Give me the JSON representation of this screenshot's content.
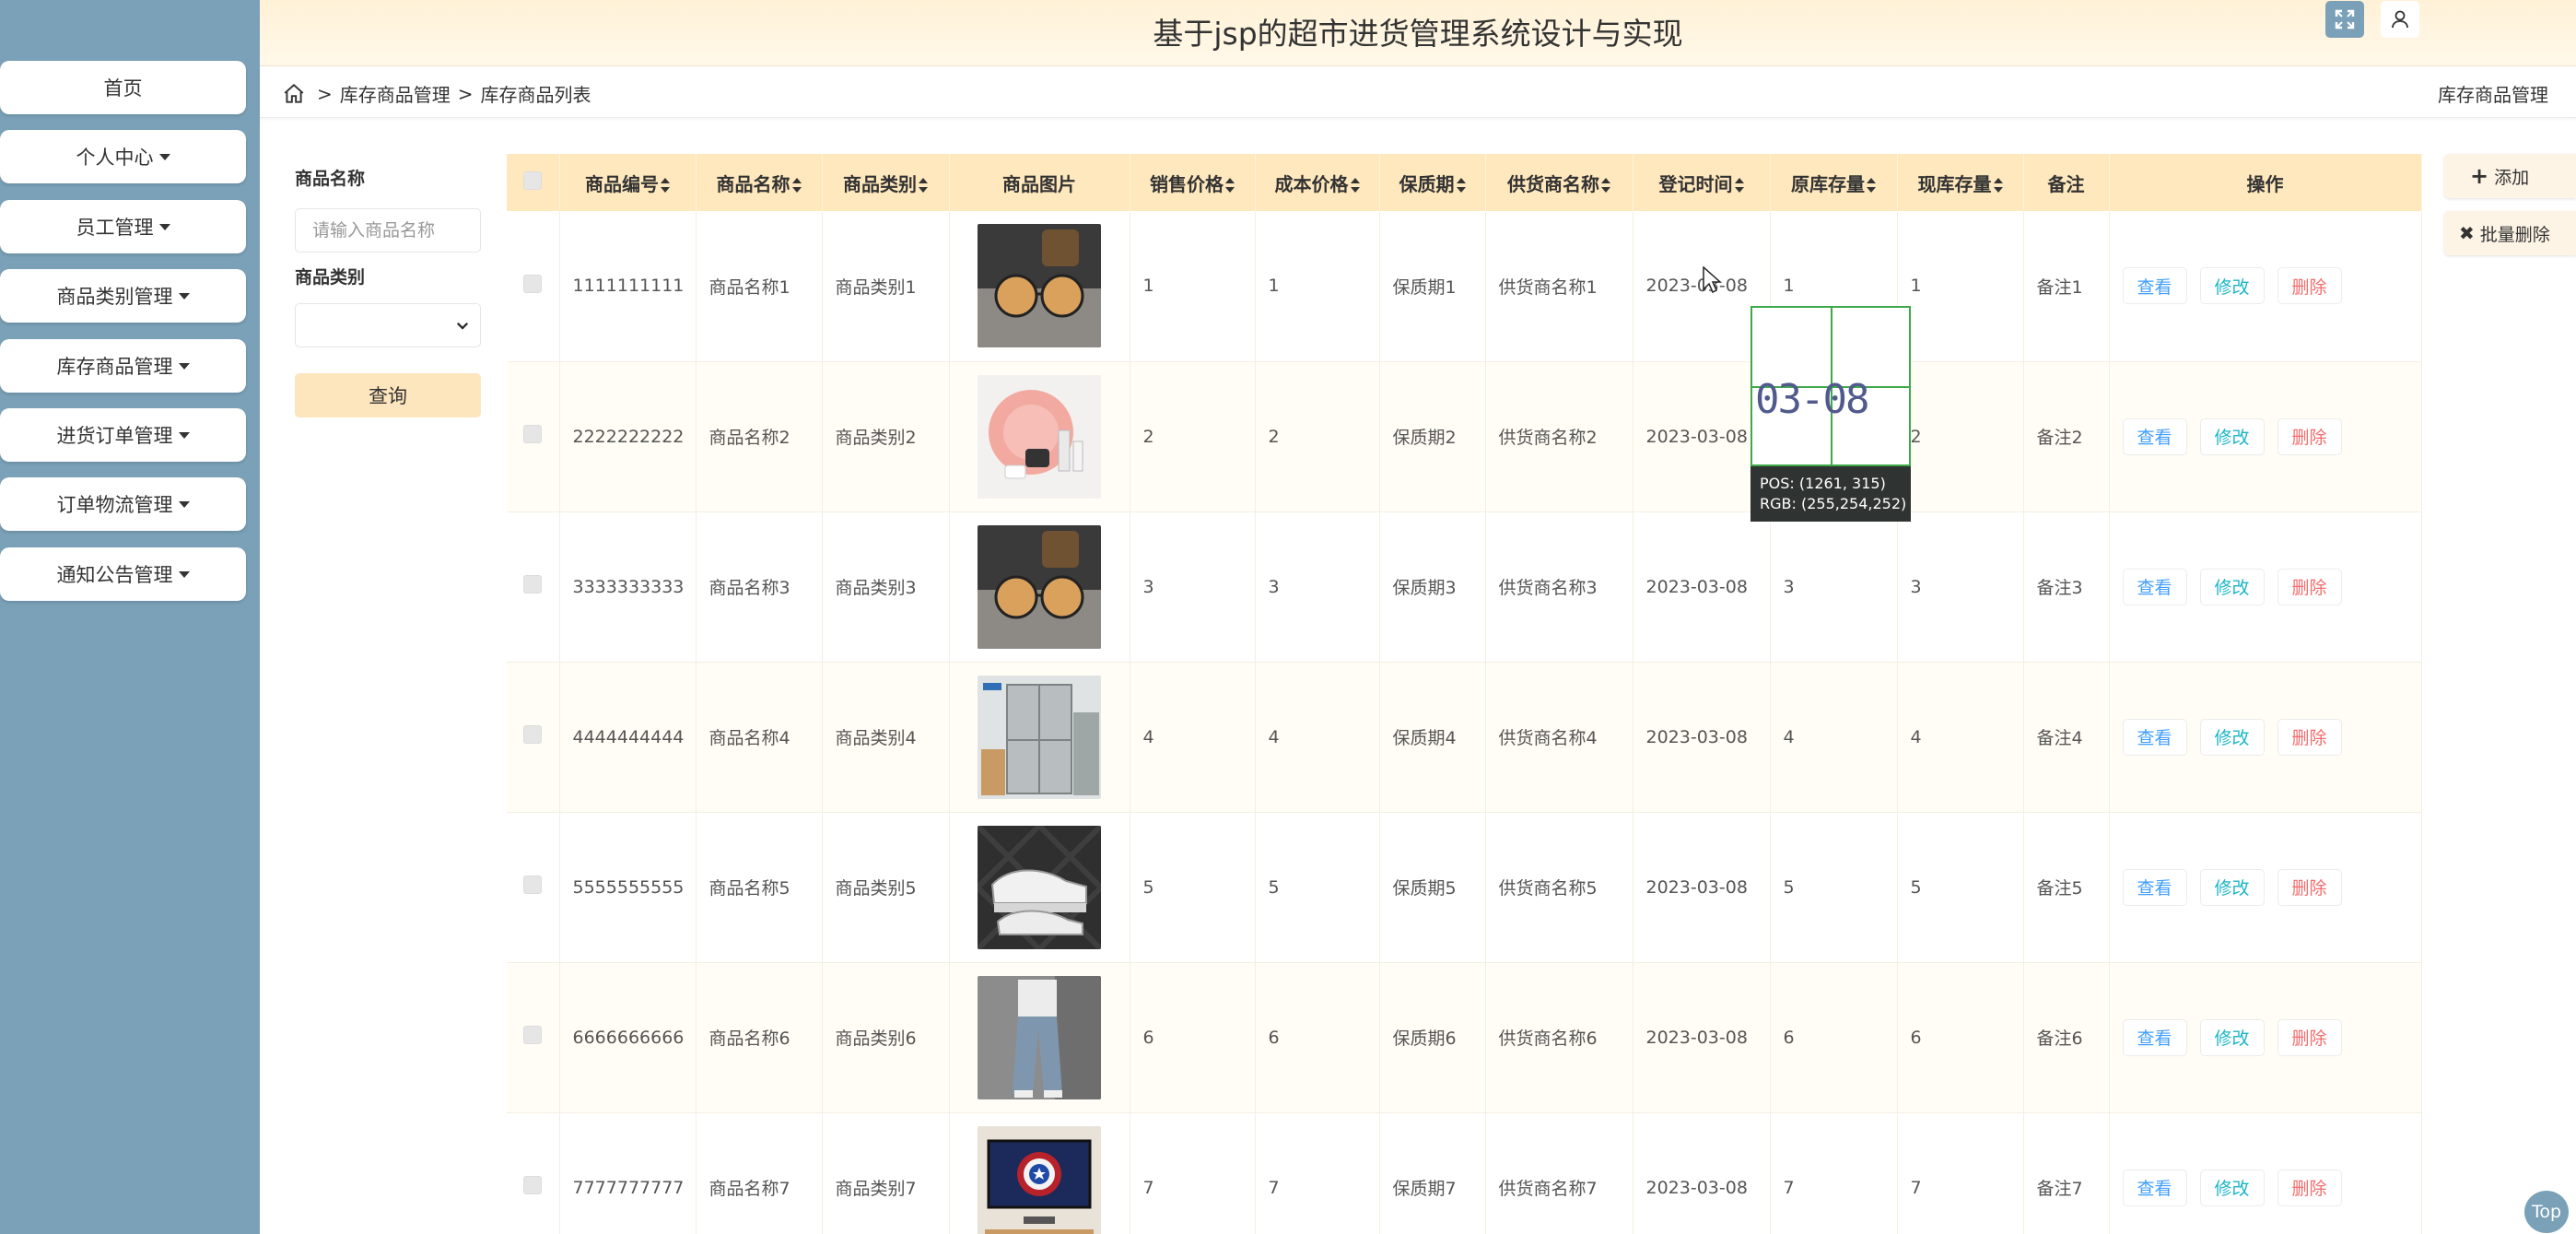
{
  "header": {
    "title": "基于jsp的超市进货管理系统设计与实现"
  },
  "sidebar": {
    "items": [
      {
        "label": "首页",
        "dropdown": false
      },
      {
        "label": "个人中心",
        "dropdown": true
      },
      {
        "label": "员工管理",
        "dropdown": true
      },
      {
        "label": "商品类别管理",
        "dropdown": true
      },
      {
        "label": "库存商品管理",
        "dropdown": true
      },
      {
        "label": "进货订单管理",
        "dropdown": true
      },
      {
        "label": "订单物流管理",
        "dropdown": true
      },
      {
        "label": "通知公告管理",
        "dropdown": true
      }
    ]
  },
  "breadcrumb": {
    "sep": ">",
    "items": [
      "库存商品管理",
      "库存商品列表"
    ],
    "right": "库存商品管理"
  },
  "search": {
    "name_label": "商品名称",
    "name_placeholder": "请输入商品名称",
    "category_label": "商品类别",
    "query_label": "查询"
  },
  "actions": {
    "add_label": "添加",
    "batch_delete_label": "批量删除"
  },
  "table": {
    "headers": [
      "商品编号",
      "商品名称",
      "商品类别",
      "商品图片",
      "销售价格",
      "成本价格",
      "保质期",
      "供货商名称",
      "登记时间",
      "原库存量",
      "现库存量",
      "备注",
      "操作"
    ],
    "op_labels": {
      "view": "查看",
      "edit": "修改",
      "delete": "删除"
    },
    "rows": [
      {
        "id": "1111111111",
        "name": "商品名称1",
        "category": "商品类别1",
        "image": "glasses",
        "price": "1",
        "cost": "1",
        "shelf": "保质期1",
        "supplier": "供货商名称1",
        "date": "2023-03-08",
        "orig": "1",
        "curr": "1",
        "note": "备注1"
      },
      {
        "id": "2222222222",
        "name": "商品名称2",
        "category": "商品类别2",
        "image": "cosmetics",
        "price": "2",
        "cost": "2",
        "shelf": "保质期2",
        "supplier": "供货商名称2",
        "date": "2023-03-08",
        "orig": "",
        "curr": "2",
        "note": "备注2"
      },
      {
        "id": "3333333333",
        "name": "商品名称3",
        "category": "商品类别3",
        "image": "glasses",
        "price": "3",
        "cost": "3",
        "shelf": "保质期3",
        "supplier": "供货商名称3",
        "date": "2023-03-08",
        "orig": "3",
        "curr": "3",
        "note": "备注3"
      },
      {
        "id": "4444444444",
        "name": "商品名称4",
        "category": "商品类别4",
        "image": "fridge",
        "price": "4",
        "cost": "4",
        "shelf": "保质期4",
        "supplier": "供货商名称4",
        "date": "2023-03-08",
        "orig": "4",
        "curr": "4",
        "note": "备注4"
      },
      {
        "id": "5555555555",
        "name": "商品名称5",
        "category": "商品类别5",
        "image": "shoes",
        "price": "5",
        "cost": "5",
        "shelf": "保质期5",
        "supplier": "供货商名称5",
        "date": "2023-03-08",
        "orig": "5",
        "curr": "5",
        "note": "备注5"
      },
      {
        "id": "6666666666",
        "name": "商品名称6",
        "category": "商品类别6",
        "image": "jeans",
        "price": "6",
        "cost": "6",
        "shelf": "保质期6",
        "supplier": "供货商名称6",
        "date": "2023-03-08",
        "orig": "6",
        "curr": "6",
        "note": "备注6"
      },
      {
        "id": "7777777777",
        "name": "商品名称7",
        "category": "商品类别7",
        "image": "monitor",
        "price": "7",
        "cost": "7",
        "shelf": "保质期7",
        "supplier": "供货商名称7",
        "date": "2023-03-08",
        "orig": "7",
        "curr": "7",
        "note": "备注7"
      }
    ]
  },
  "magnifier": {
    "zoom_text": "03-08",
    "pos_label": "POS:",
    "pos_value": "(1261, 315)",
    "rgb_label": "RGB:",
    "rgb_value": "(255,254,252)"
  },
  "top_button": "Top",
  "colors": {
    "sidebar": "#7aa1b8",
    "header": "#fff1d6",
    "table_header": "#ffe8bd",
    "view": "#409eff",
    "edit": "#1cb5c9",
    "delete": "#f56c6c"
  }
}
